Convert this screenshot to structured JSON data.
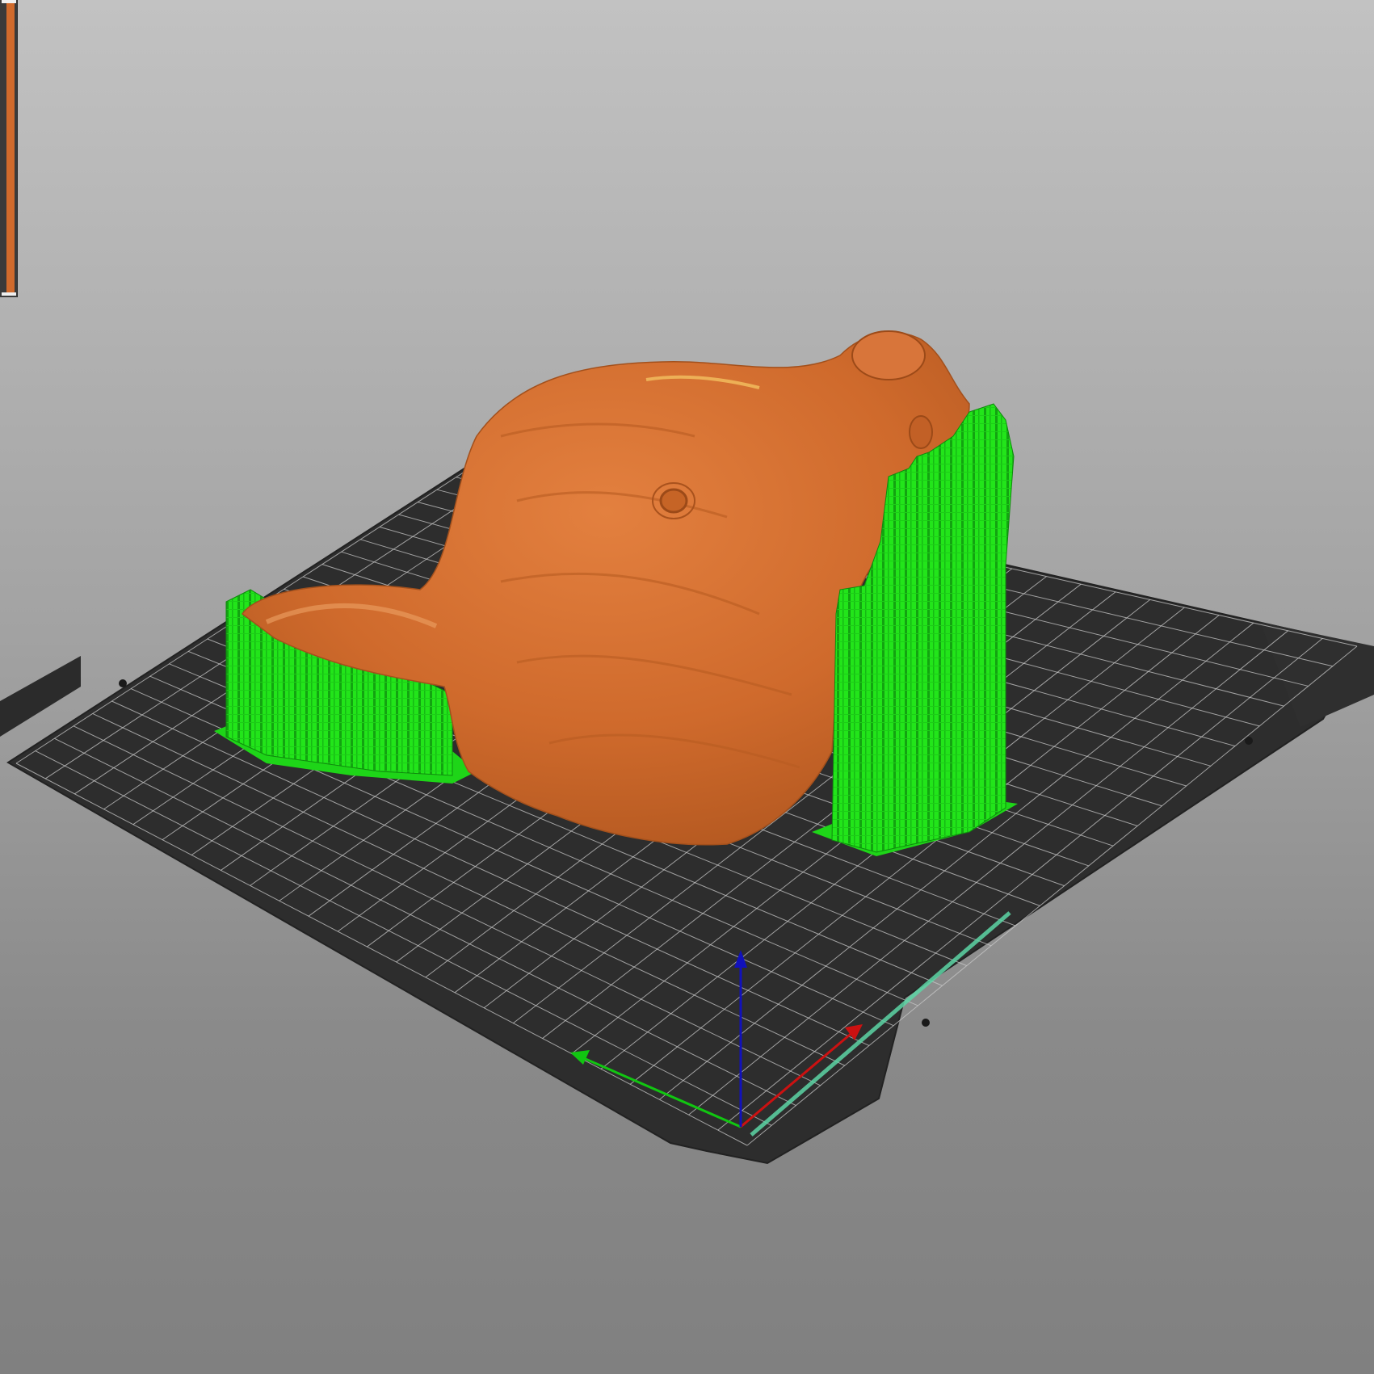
{
  "app": {
    "view": "Preview"
  },
  "colors": {
    "background_top": "#c2c2c2",
    "background_bottom": "#808080",
    "bed": "#2d2d2d",
    "bed_grid": "#d0d0d0",
    "model": "#d06a2c",
    "model_highlight": "#e08040",
    "support": "#22e51a",
    "support_dark": "#12a010",
    "axis_x": "#cc1111",
    "axis_y": "#11c611",
    "axis_z": "#1111bb",
    "bed_edge_highlight": "#5dd6a6",
    "layer_slider": "#d06a2c"
  },
  "scene": {
    "bed": {
      "label": "print-bed",
      "grid_divisions": 25
    },
    "model": {
      "label": "animal-head-model",
      "icon": "sliced-model"
    },
    "supports": [
      {
        "label": "left-support-tower"
      },
      {
        "label": "right-support-tower"
      }
    ],
    "axes": {
      "x": "X",
      "y": "Y",
      "z": "Z"
    }
  },
  "layer_slider": {
    "icon": "layer-slider"
  }
}
